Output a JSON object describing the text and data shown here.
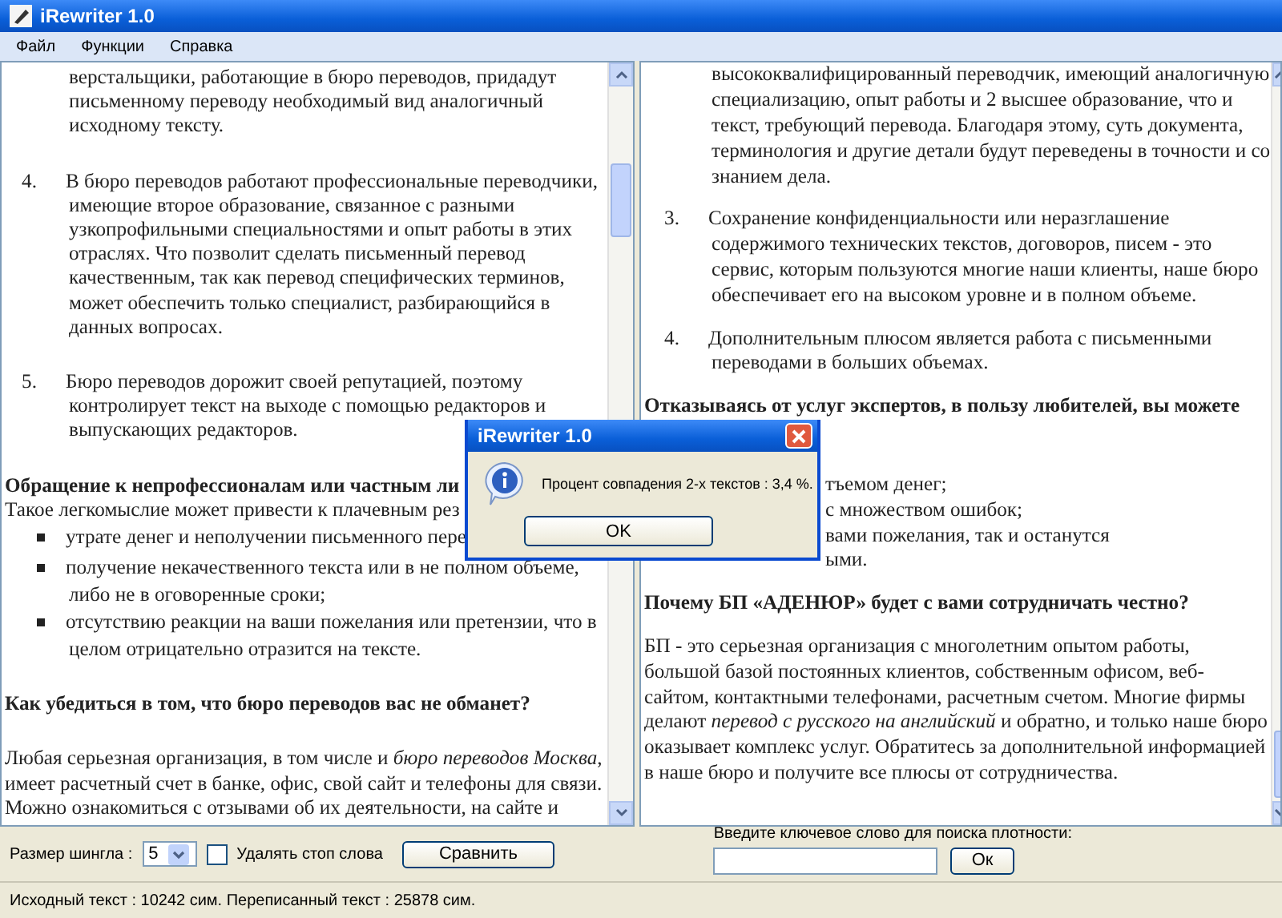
{
  "window": {
    "title": "iRewriter 1.0"
  },
  "menu": [
    {
      "label": "Файл"
    },
    {
      "label": "Функции"
    },
    {
      "label": "Справка"
    }
  ],
  "panels": [
    {
      "lines": [
        {
          "kind": "cont",
          "text": "верстальщики, работающие в бюро переводов, придадут"
        },
        {
          "kind": "cont",
          "text": "письменному переводу необходимый вид аналогичный"
        },
        {
          "kind": "cont",
          "text": "исходному тексту."
        },
        {
          "kind": "blank"
        },
        {
          "kind": "item",
          "marker": "4.",
          "text": "В бюро переводов работают профессиональные переводчики,"
        },
        {
          "kind": "cont",
          "text": "имеющие второе образование, связанное с разными"
        },
        {
          "kind": "cont",
          "text": "узкопрофильными специальностями и опыт работы в этих"
        },
        {
          "kind": "cont",
          "text": "отраслях. Что позволит сделать письменный перевод"
        },
        {
          "kind": "cont",
          "text": "качественным, так как перевод специфических терминов,"
        },
        {
          "kind": "cont",
          "text": "может обеспечить только специалист, разбирающийся в"
        },
        {
          "kind": "cont",
          "text": "данных вопросах."
        },
        {
          "kind": "blank"
        },
        {
          "kind": "item",
          "marker": "5.",
          "text": "Бюро переводов дорожит своей репутацией, поэтому"
        },
        {
          "kind": "cont",
          "text": "контролирует текст на выходе с помощью  редакторов и"
        },
        {
          "kind": "cont",
          "text": "выпускающих редакторов."
        },
        {
          "kind": "blank"
        },
        {
          "kind": "heading",
          "text": "Обращение к непрофессионалам или частным ли"
        },
        {
          "kind": "text",
          "text": "Такое легкомыслие может привести к плачевным рез"
        },
        {
          "kind": "bullet",
          "text": "утрате денег и неполучении письменного пере"
        },
        {
          "kind": "bullet",
          "text": "получение некачественного текста или в не полном объеме,"
        },
        {
          "kind": "cont",
          "text": "либо не в оговоренные сроки;"
        },
        {
          "kind": "bullet",
          "text": "отсутствию реакции на ваши пожелания или претензии, что в"
        },
        {
          "kind": "cont",
          "text": "целом отрицательно отразится на тексте."
        },
        {
          "kind": "blank"
        },
        {
          "kind": "heading",
          "text": "Как убедиться в том, что бюро переводов вас не обманет?"
        },
        {
          "kind": "blank"
        },
        {
          "kind": "text",
          "text": "Любая серьезная организация, в том числе и *бюро переводов Москва*,"
        },
        {
          "kind": "text",
          "text": "имеет расчетный счет  в банке, офис, свой сайт и телефоны для связи."
        },
        {
          "kind": "text",
          "text": "Можно ознакомиться с отзывами об их деятельности, на сайте и"
        }
      ]
    },
    {
      "lines": [
        {
          "kind": "cont",
          "text": "высококвалифицированный переводчик, имеющий аналогичную"
        },
        {
          "kind": "cont",
          "text": "специализацию, опыт работы и 2 высшее образование, что и"
        },
        {
          "kind": "cont",
          "text": "текст, требующий перевода. Благодаря этому, суть документа,"
        },
        {
          "kind": "cont",
          "text": "терминология и другие детали будут переведены в точности и со"
        },
        {
          "kind": "cont",
          "text": "знанием дела."
        },
        {
          "kind": "blank"
        },
        {
          "kind": "item",
          "marker": "3.",
          "text": "Сохранение конфиденциальности или  неразглашение"
        },
        {
          "kind": "cont",
          "text": "содержимого технических текстов, договоров, писем - это"
        },
        {
          "kind": "cont",
          "text": "сервис, которым пользуются многие наши клиенты, наше бюро"
        },
        {
          "kind": "cont",
          "text": "обеспечивает его на высоком уровне и в полном объеме."
        },
        {
          "kind": "blank"
        },
        {
          "kind": "item",
          "marker": "4.",
          "text": "Дополнительным плюсом является работа с письменными"
        },
        {
          "kind": "cont",
          "text": "переводами в больших объемах."
        },
        {
          "kind": "blank"
        },
        {
          "kind": "heading",
          "text": "Отказываясь от услуг экспертов, в пользу любителей, вы можете"
        },
        {
          "kind": "blank"
        },
        {
          "kind": "blank"
        },
        {
          "kind": "blank"
        },
        {
          "kind": "fragment",
          "text": "тъемом денег;"
        },
        {
          "kind": "fragment",
          "text": "с множеством ошибок;"
        },
        {
          "kind": "fragment",
          "text": "вами пожелания, так и останутся"
        },
        {
          "kind": "fragment",
          "text": "ыми."
        },
        {
          "kind": "blank"
        },
        {
          "kind": "heading",
          "text": "Почему БП «АДЕНЮР» будет с вами сотрудничать честно?"
        },
        {
          "kind": "blank"
        },
        {
          "kind": "text",
          "text": "БП - это серьезная организация с многолетним опытом работы,"
        },
        {
          "kind": "text",
          "text": "большой базой постоянных клиентов, собственным офисом, веб-"
        },
        {
          "kind": "text",
          "text": "сайтом, контактными телефонами, расчетным счетом. Многие фирмы"
        },
        {
          "kind": "text",
          "text": "делают *перевод с русского на английский* и обратно, и только наше бюро"
        },
        {
          "kind": "text",
          "text": "оказывает комплекс услуг. Обратитесь за дополнительной информацией"
        },
        {
          "kind": "text",
          "text": "в наше бюро и получите все плюсы от сотрудничества."
        }
      ]
    }
  ],
  "options": {
    "shingle_label": "Размер шингла :",
    "shingle_value": "5",
    "remove_stop_words": {
      "label": "Удалять стоп слова",
      "checked": false
    },
    "compare_button": "Сравнить"
  },
  "keyword": {
    "label": "Введите ключевое слово для поиска плотности:",
    "button": "Ок"
  },
  "status_bar": {
    "text": "Исходный текст : 10242 сим.  Переписанный текст : 25878 сим."
  },
  "dialog": {
    "title": "iRewriter 1.0",
    "message": "Процент совпадения 2-х текстов : 3,4 %.",
    "button": "OK"
  }
}
